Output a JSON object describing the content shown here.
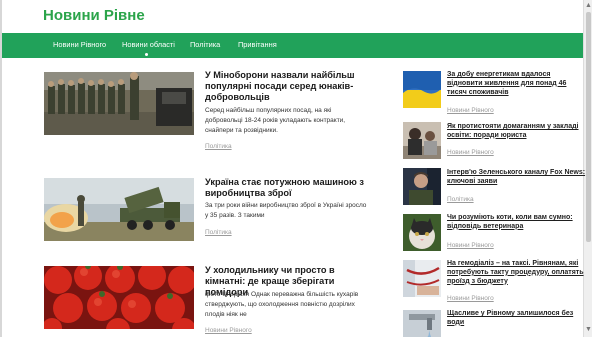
{
  "site": {
    "title": "Новини Рівне"
  },
  "nav": [
    {
      "label": "Новини Рівного"
    },
    {
      "label": "Новини області"
    },
    {
      "label": "Політика"
    },
    {
      "label": "Привітання"
    }
  ],
  "articles": [
    {
      "title": "У Міноборони назвали найбільш популярні посади серед юнаків-добровольців",
      "excerpt": "Серед найбільш популярних посад, на які добровольці 18-24 років укладають контракти, снайпери та розвідники.",
      "category": "Політика"
    },
    {
      "title": "Україна стає потужною машиною з виробництва зброї",
      "excerpt": "За три роки війни виробництво зброї в Україні зросло у 35 разів. З такими",
      "category": "Політика"
    },
    {
      "title": "У холодильнику чи просто в кімнатні: де краще зберігати помідори",
      "excerpt": "фото Unsplash Однак переважна більшість кухарів стверджують, що охолодження повністю дозрілих плодів  ніяк не",
      "category": "Новини Рівного"
    }
  ],
  "sidebar": [
    {
      "title": "За добу енергетикам вдалося відновити живлення для понад 46 тисяч споживачів",
      "category": "Новини Рівного"
    },
    {
      "title": "Як протистояти домаганням у закладі освіти: поради юриста",
      "category": "Новини Рівного"
    },
    {
      "title": "Інтерв'ю Зеленського каналу Fox News: ключові заяви",
      "category": "Політика"
    },
    {
      "title": "Чи розуміють коти, коли вам сумно: відповідь ветеринара",
      "category": "Новини Рівного"
    },
    {
      "title": "На гемодіаліз – на таксі. Рівнянам, які потребують такту процедуру, оплатять проїзд з бюджету",
      "category": "Новини Рівного"
    },
    {
      "title": "Щасливе у Рівному залишилося без води",
      "category": ""
    }
  ],
  "colors": {
    "brand": "#2ba44a",
    "nav_bg": "#21a25a",
    "meta": "#9a9a9a"
  }
}
